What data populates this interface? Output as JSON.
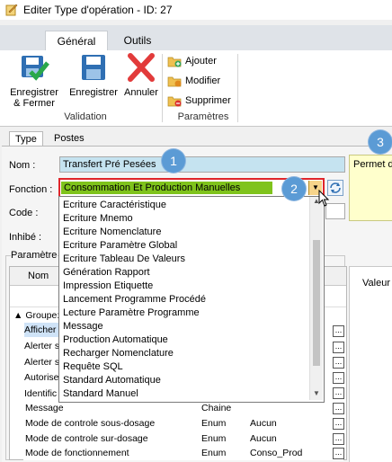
{
  "window": {
    "title": "Editer Type d'opération - ID: 27"
  },
  "ribbon": {
    "tabs": [
      {
        "label": "Général"
      },
      {
        "label": "Outils"
      }
    ],
    "validation": {
      "group_label": "Validation",
      "save_close": "Enregistrer\n& Fermer",
      "save": "Enregistrer",
      "cancel": "Annuler"
    },
    "parametres": {
      "group_label": "Paramètres",
      "add": "Ajouter",
      "modify": "Modifier",
      "delete": "Supprimer"
    }
  },
  "form": {
    "tabs": [
      {
        "label": "Type"
      },
      {
        "label": "Postes"
      }
    ],
    "nom_label": "Nom :",
    "nom_value": "Transfert Pré Pesées",
    "fonction_label": "Fonction :",
    "fonction_value": "Consommation Et Production Manuelles",
    "code_label": "Code :",
    "inhibe_label": "Inhibé :",
    "params_label": "Paramètre",
    "description_text": "Permet de",
    "valeur_label": "Valeur"
  },
  "callouts": [
    "1",
    "2",
    "3"
  ],
  "dropdown": {
    "items": [
      "Ecriture Caractéristique",
      "Ecriture Mnemo",
      "Ecriture Nomenclature",
      "Ecriture Paramètre Global",
      "Ecriture Tableau De Valeurs",
      "Génération Rapport",
      "Impression Etiquette",
      "Lancement Programme Procédé",
      "Lecture Paramètre Programme",
      "Message",
      "Production Automatique",
      "Recharger Nomenclature",
      "Requête SQL",
      "Standard Automatique",
      "Standard Manuel"
    ]
  },
  "grid": {
    "col_nom": "Nom",
    "group_label": "Groupe:",
    "partial_rows": [
      "Afficher",
      "Alerter s",
      "Alerter s",
      "Autorise",
      "Identific"
    ],
    "rows": [
      {
        "name": "Message",
        "type": "Chaine",
        "value": ""
      },
      {
        "name": "Mode de controle sous-dosage",
        "type": "Enum",
        "value": "Aucun"
      },
      {
        "name": "Mode de controle sur-dosage",
        "type": "Enum",
        "value": "Aucun"
      },
      {
        "name": "Mode de fonctionnement",
        "type": "Enum",
        "value": "Conso_Prod"
      }
    ],
    "ellipsis": "..."
  },
  "colors": {
    "accent": "#5b9bd5",
    "nom_field_bg": "#c5e3f0",
    "fonction_highlight": "#7fc31c",
    "fonction_border": "#e0262b",
    "description_bg": "#ffffcc"
  },
  "icons": [
    "app-icon",
    "save-close-icon",
    "save-icon",
    "cancel-icon",
    "add-icon",
    "modify-icon",
    "delete-icon",
    "dropdown-arrow-icon",
    "refresh-icon",
    "scroll-up-icon",
    "scroll-down-icon"
  ]
}
